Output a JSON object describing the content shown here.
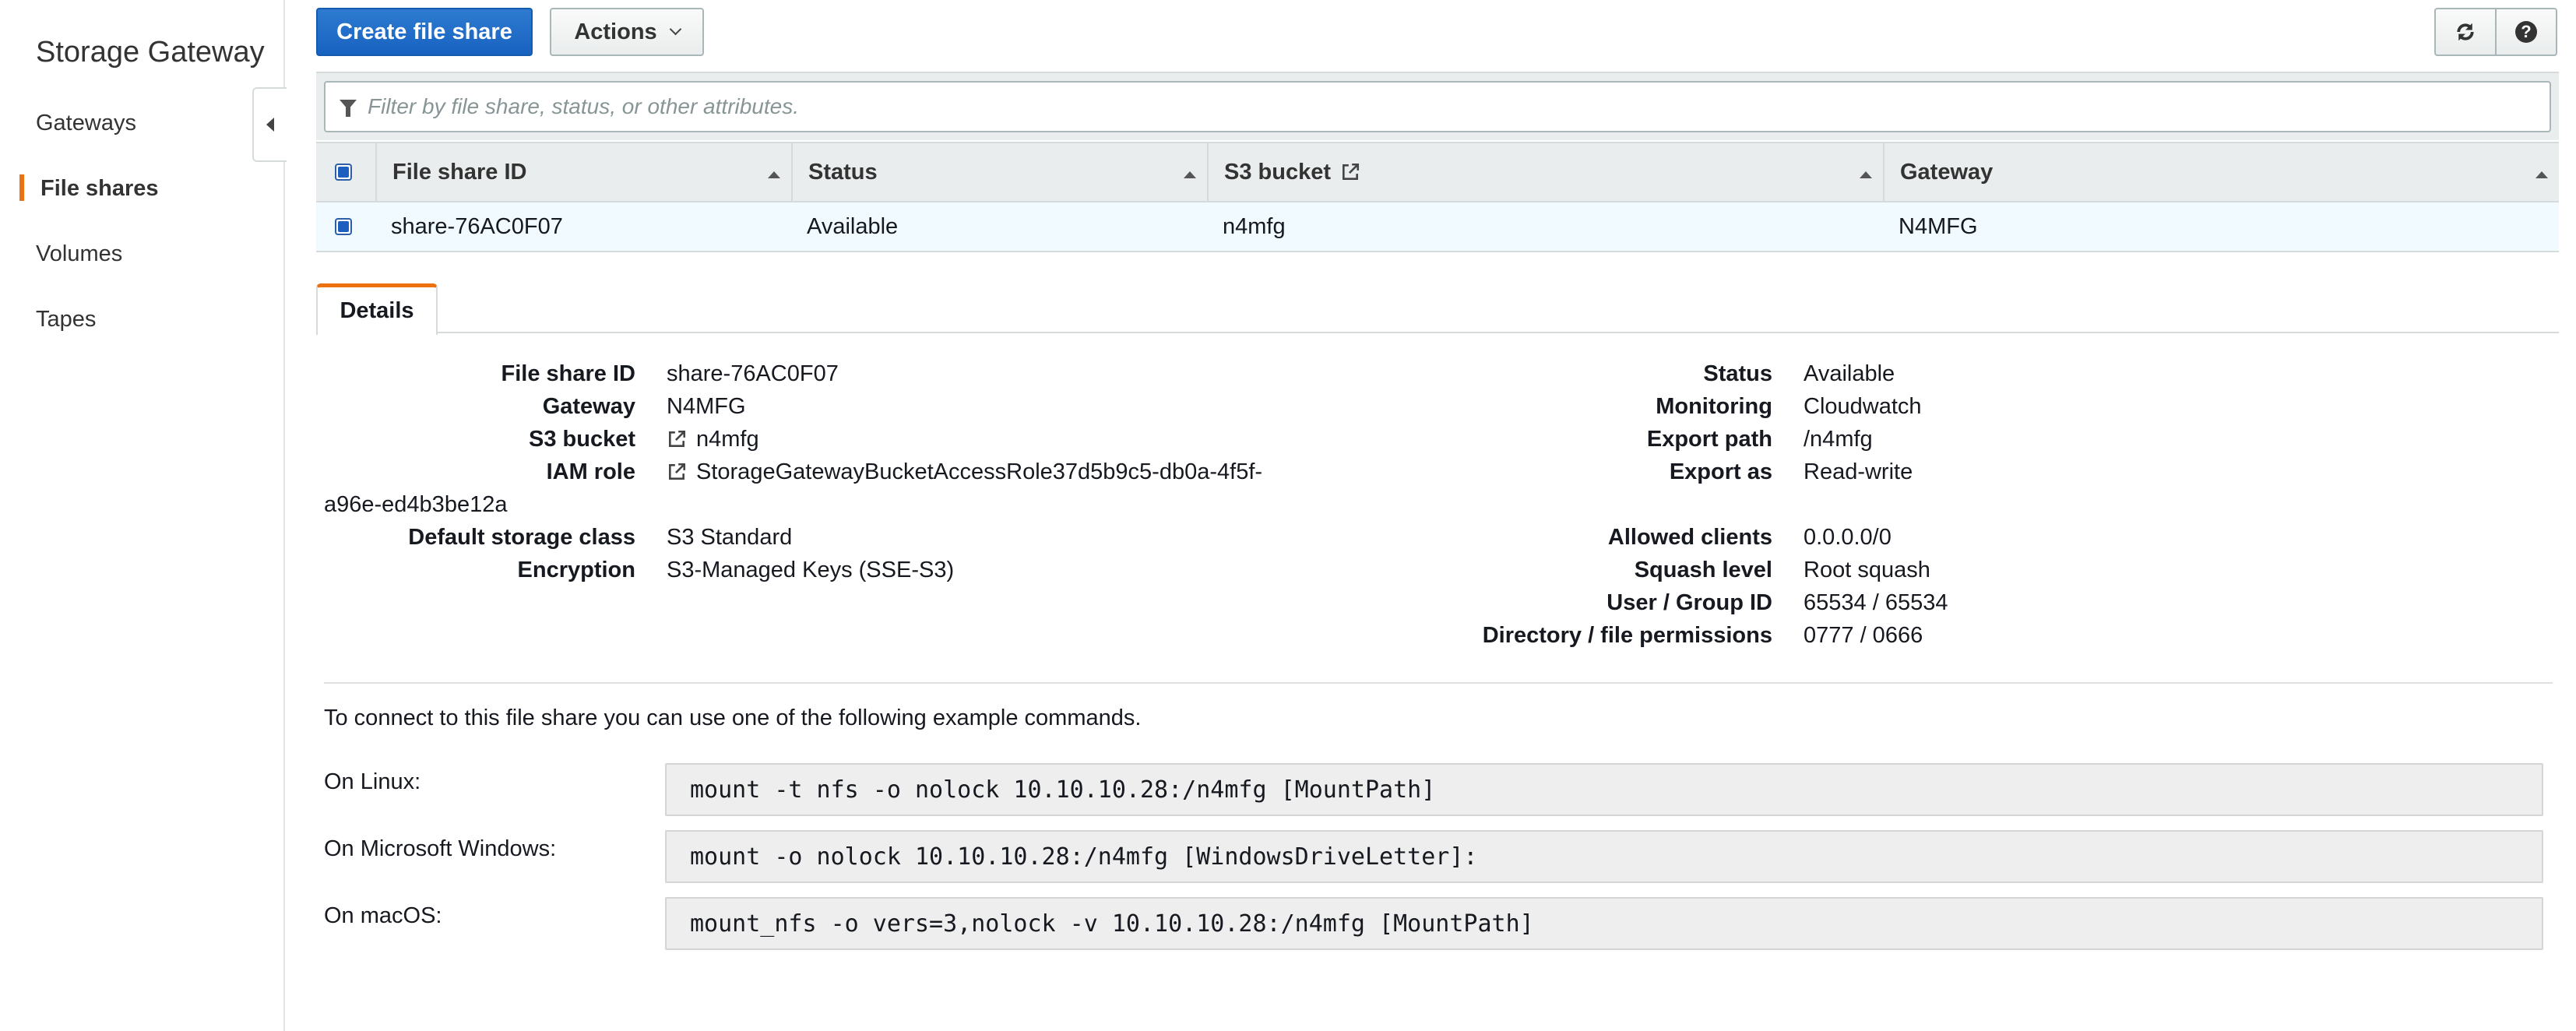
{
  "sidebar": {
    "title": "Storage Gateway",
    "items": [
      {
        "label": "Gateways"
      },
      {
        "label": "File shares"
      },
      {
        "label": "Volumes"
      },
      {
        "label": "Tapes"
      }
    ]
  },
  "toolbar": {
    "create_label": "Create file share",
    "actions_label": "Actions"
  },
  "filter": {
    "placeholder": "Filter by file share, status, or other attributes."
  },
  "table": {
    "columns": [
      "File share ID",
      "Status",
      "S3 bucket",
      "Gateway"
    ],
    "rows": [
      {
        "id": "share-76AC0F07",
        "status": "Available",
        "bucket": "n4mfg",
        "gateway": "N4MFG"
      }
    ]
  },
  "tabs": {
    "details": "Details"
  },
  "details": {
    "left": {
      "file_share_id_label": "File share ID",
      "file_share_id": "share-76AC0F07",
      "gateway_label": "Gateway",
      "gateway": "N4MFG",
      "s3_bucket_label": "S3 bucket",
      "s3_bucket": "n4mfg",
      "iam_role_label": "IAM role",
      "iam_role_line1": "StorageGatewayBucketAccessRole37d5b9c5-db0a-4f5f-",
      "iam_role_line2": "a96e-ed4b3be12a",
      "storage_class_label": "Default storage class",
      "storage_class": "S3 Standard",
      "encryption_label": "Encryption",
      "encryption": "S3-Managed Keys (SSE-S3)"
    },
    "right": {
      "status_label": "Status",
      "status": "Available",
      "monitoring_label": "Monitoring",
      "monitoring": "Cloudwatch",
      "export_path_label": "Export path",
      "export_path": "/n4mfg",
      "export_as_label": "Export as",
      "export_as": "Read-write",
      "allowed_clients_label": "Allowed clients",
      "allowed_clients": "0.0.0.0/0",
      "squash_label": "Squash level",
      "squash": "Root squash",
      "user_group_label": "User / Group ID",
      "user_group": "65534 / 65534",
      "permissions_label": "Directory / file permissions",
      "permissions": "0777 / 0666"
    }
  },
  "commands": {
    "intro": "To connect to this file share you can use one of the following example commands.",
    "linux_label": "On Linux:",
    "linux": "mount -t nfs -o nolock 10.10.10.28:/n4mfg [MountPath]",
    "windows_label": "On Microsoft Windows:",
    "windows": "mount -o nolock 10.10.10.28:/n4mfg [WindowsDriveLetter]:",
    "mac_label": "On macOS:",
    "mac": "mount_nfs -o vers=3,nolock -v 10.10.10.28:/n4mfg [MountPath]"
  },
  "colors": {
    "accent": "#ec7211",
    "primary": "#1762c0",
    "link": "#0e5fb5"
  },
  "icons": [
    "caret-left-icon",
    "chevron-down-icon",
    "refresh-icon",
    "help-icon",
    "filter-icon",
    "sort-up-icon",
    "external-link-icon"
  ]
}
